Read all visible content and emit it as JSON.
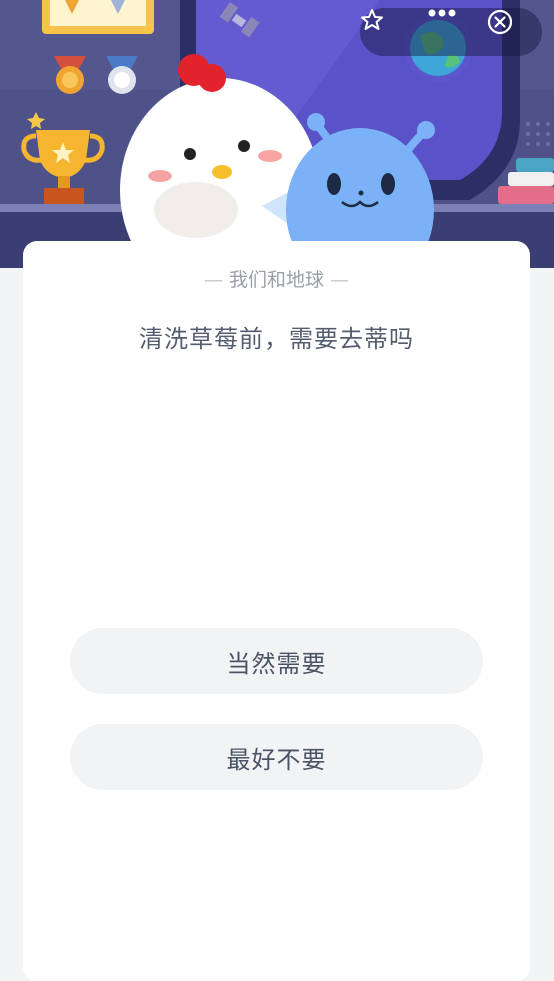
{
  "header": {
    "star_icon": "star-outline-icon",
    "more_icon": "more-dots-icon",
    "close_icon": "close-circle-icon"
  },
  "quiz": {
    "category": "我们和地球",
    "question": "清洗草莓前，需要去蒂吗",
    "options": [
      {
        "label": "当然需要"
      },
      {
        "label": "最好不要"
      }
    ]
  },
  "colors": {
    "banner_bg": "#4b4f86",
    "window_frame": "#2c2f66",
    "card_bg": "#ffffff",
    "option_bg": "#f2f3f5",
    "text_main": "#545d70"
  }
}
